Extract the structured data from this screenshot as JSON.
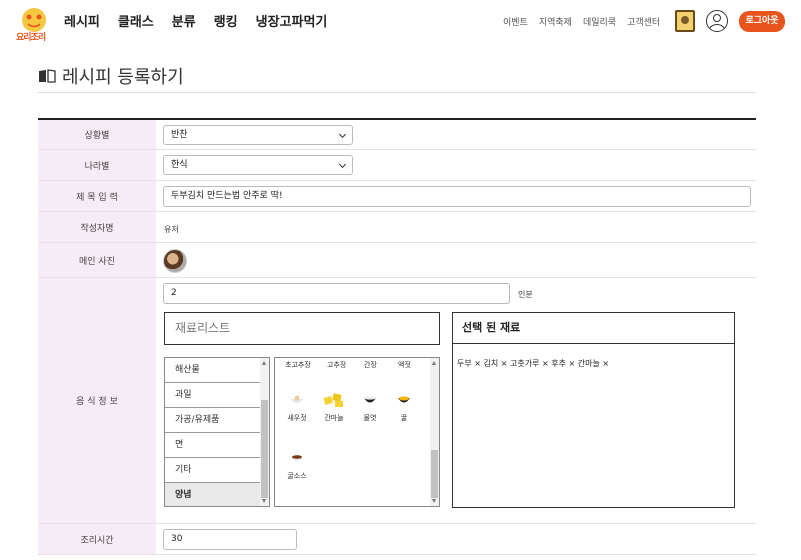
{
  "brand": {
    "logo_text": "요리조리",
    "accent": "#e8541c"
  },
  "nav": {
    "main": [
      "레시피",
      "클래스",
      "분류",
      "랭킹",
      "냉장고파먹기"
    ],
    "sub": [
      "이벤트",
      "지역축제",
      "데일리쿡",
      "고객센터"
    ],
    "logout": "로그아웃"
  },
  "page": {
    "title": "레시피 등록하기"
  },
  "form": {
    "situation": {
      "label": "상황별",
      "value": "반찬"
    },
    "country": {
      "label": "나라별",
      "value": "한식"
    },
    "title_field": {
      "label": "제 목 입 력",
      "value": "두부김치 만드는법 안주로 딱!"
    },
    "writer": {
      "label": "작성자명",
      "value": "유저"
    },
    "photo": {
      "label": "메인 사진"
    },
    "food_info": {
      "label": "음 식 정 보",
      "servings": "2",
      "servings_unit": "인분",
      "ingredient_list_title": "재료리스트",
      "selected_title": "선택 된 재료",
      "categories": [
        "해산물",
        "과일",
        "가공/유제품",
        "면",
        "기타",
        "양념"
      ],
      "active_category": "양념",
      "grid_headers": [
        "초고추장",
        "고추장",
        "간장",
        "액젓"
      ],
      "ingredients": [
        "새우젓",
        "간마늘",
        "물엿",
        "꿀",
        "굴소스"
      ],
      "selected": "두부 ×  김치 ×  고춧가루 ×  후추 ×  간마늘 ×"
    },
    "cook_time": {
      "label": "조리시간",
      "value": "30"
    }
  }
}
